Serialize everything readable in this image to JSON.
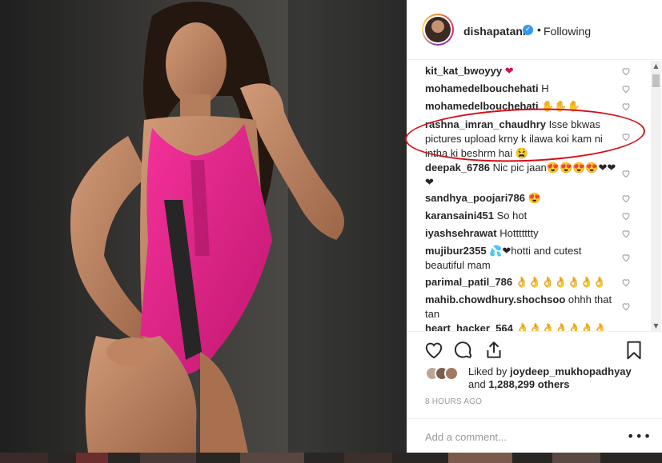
{
  "header": {
    "username": "dishapatani",
    "dot": "•",
    "follow_status": "Following",
    "verified_glyph": "✓"
  },
  "comments": [
    {
      "user": "kit_kat_bwoyyy",
      "text": "❤"
    },
    {
      "user": "mohamedelbouchehati",
      "text": "H"
    },
    {
      "user": "mohamedelbouchehati",
      "text": "✋✋✋"
    },
    {
      "user": "rashna_imran_chaudhry",
      "text": "Isse bkwas pictures upload krny k ilawa koi kam ni intha ki beshrm hai 😫"
    },
    {
      "user": "deepak_6786",
      "text": "Nic pic jaan😍😍😍😍❤❤❤"
    },
    {
      "user": "sandhya_poojari786",
      "text": "😍"
    },
    {
      "user": "karansaini451",
      "text": "So hot"
    },
    {
      "user": "iyashsehrawat",
      "text": "Hottttttty"
    },
    {
      "user": "mujibur2355",
      "text": "💦❤hotti and cutest beautiful mam"
    },
    {
      "user": "parimal_patil_786",
      "text": "👌👌👌👌👌👌👌"
    },
    {
      "user": "mahib.chowdhury.shochsoo",
      "text": "ohhh that tan"
    },
    {
      "user": "heart_hacker_564",
      "text": "👌👌👌👌👌👌👌👌👌"
    }
  ],
  "icons": {
    "like": "heart-icon",
    "comment": "comment-icon",
    "share": "share-icon",
    "save": "bookmark-icon",
    "more": "more-options-icon"
  },
  "likes": {
    "prefix": "Liked by ",
    "user": "joydeep_mukhopadhyay",
    "and": "and ",
    "others": "1,288,299 others"
  },
  "timestamp": "8 HOURS AGO",
  "add_comment": {
    "placeholder": "Add a comment...",
    "more_glyph": "•••"
  },
  "scroll": {
    "up": "▲",
    "down": "▼"
  }
}
